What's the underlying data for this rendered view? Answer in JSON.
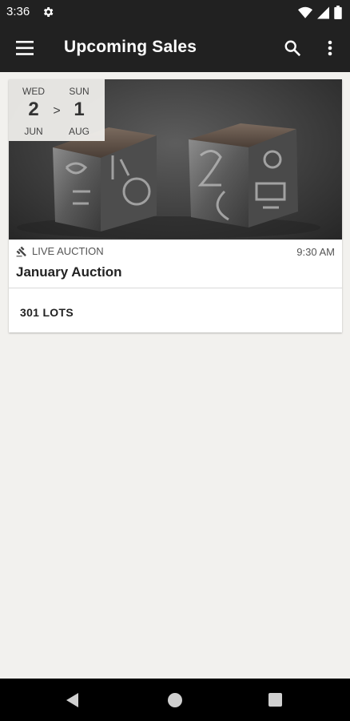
{
  "status_bar": {
    "time": "3:36",
    "icons": [
      "gear-icon",
      "wifi-icon",
      "signal-icon",
      "battery-icon"
    ]
  },
  "app_bar": {
    "title": "Upcoming Sales",
    "icons": [
      "menu-icon",
      "search-icon",
      "more-vert-icon"
    ]
  },
  "sales": [
    {
      "start": {
        "weekday": "WED",
        "day": "2",
        "month": "JUN"
      },
      "separator": ">",
      "end": {
        "weekday": "SUN",
        "day": "1",
        "month": "AUG"
      },
      "type": "LIVE AUCTION",
      "type_icon": "gavel-icon",
      "time": "9:30 AM",
      "title": "January Auction",
      "lots": "301 LOTS"
    }
  ],
  "nav_bar": {
    "icons": [
      "back-icon",
      "home-icon",
      "recents-icon"
    ]
  },
  "colors": {
    "bar": "#212121",
    "background": "#f2f1ee",
    "card": "#ffffff"
  }
}
